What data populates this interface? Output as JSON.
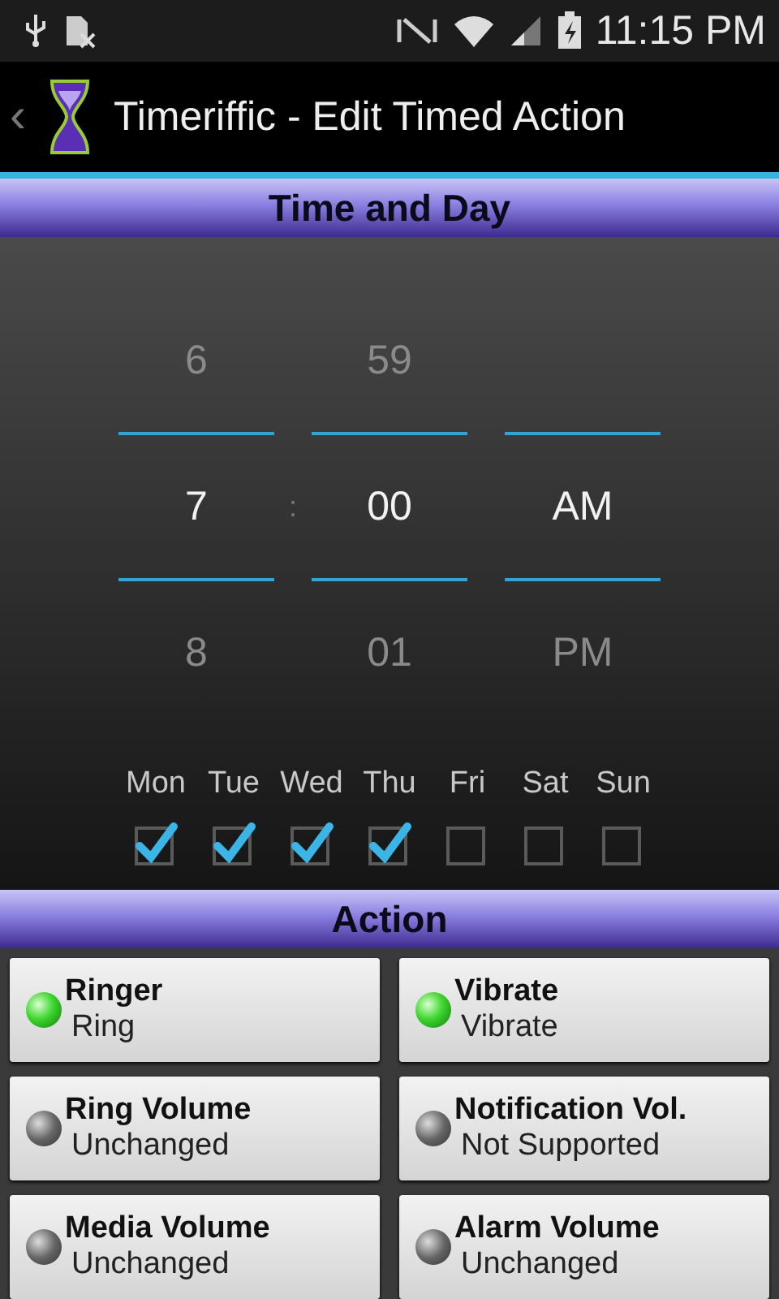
{
  "status_bar": {
    "time": "11:15 PM"
  },
  "action_bar": {
    "back": "‹",
    "title": "Timeriffic - Edit Timed Action"
  },
  "time_section": {
    "header": "Time and Day",
    "picker": {
      "separator": ":",
      "columns": [
        {
          "above": "6",
          "value": "7",
          "below": "8"
        },
        {
          "above": "59",
          "value": "00",
          "below": "01"
        },
        {
          "value": "AM",
          "below": "PM"
        }
      ]
    },
    "days": [
      {
        "label": "Mon",
        "checked": true
      },
      {
        "label": "Tue",
        "checked": true
      },
      {
        "label": "Wed",
        "checked": true
      },
      {
        "label": "Thu",
        "checked": true
      },
      {
        "label": "Fri",
        "checked": false
      },
      {
        "label": "Sat",
        "checked": false
      },
      {
        "label": "Sun",
        "checked": false
      }
    ]
  },
  "action_section": {
    "header": "Action",
    "items": [
      {
        "title": "Ringer",
        "value": "Ring",
        "on": true
      },
      {
        "title": "Vibrate",
        "value": "Vibrate",
        "on": true
      },
      {
        "title": "Ring Volume",
        "value": "Unchanged",
        "on": false
      },
      {
        "title": "Notification Vol.",
        "value": "Not Supported",
        "on": false
      },
      {
        "title": "Media Volume",
        "value": "Unchanged",
        "on": false
      },
      {
        "title": "Alarm Volume",
        "value": "Unchanged",
        "on": false
      }
    ]
  }
}
